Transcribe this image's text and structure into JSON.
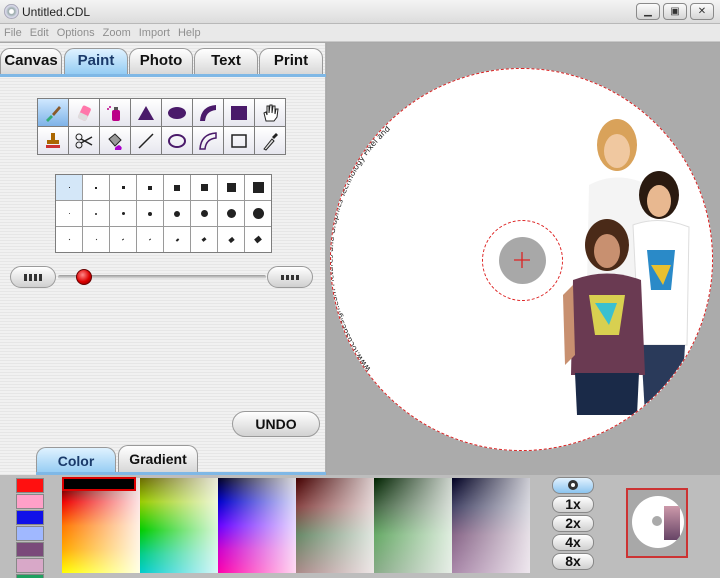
{
  "window": {
    "title": "Untitled.CDL"
  },
  "menu": [
    "File",
    "Edit",
    "Options",
    "Zoom",
    "Import",
    "Help"
  ],
  "tabs": [
    "Canvas",
    "Paint",
    "Photo",
    "Text",
    "Print"
  ],
  "active_tab": "Paint",
  "tools": [
    "paintbrush-icon",
    "eraser-icon",
    "spray-can-icon",
    "filled-triangle-icon",
    "filled-ellipse-icon",
    "filled-arc-icon",
    "filled-rectangle-icon",
    "hand-icon",
    "stamp-icon",
    "scissors-icon",
    "paint-bucket-icon",
    "line-icon",
    "ellipse-outline-icon",
    "arc-outline-icon",
    "rectangle-outline-icon",
    "eyedropper-icon"
  ],
  "undo_label": "UNDO",
  "subtabs": [
    "Color",
    "Gradient"
  ],
  "active_subtab": "Color",
  "disc_text": "www.focusdesign.com  Pictures and Graphics  Technology  Pixel and design digital",
  "zoom_levels": [
    "1x",
    "2x",
    "4x",
    "8x"
  ],
  "swatch_colors": [
    "#ff1010",
    "#ffa0c8",
    "#1010e8",
    "#a0b8ff",
    "#7a4a7a",
    "#d8a8c8",
    "#20a060"
  ],
  "brush_slider_value": 0.1,
  "accent_color": "#8ec9f2"
}
